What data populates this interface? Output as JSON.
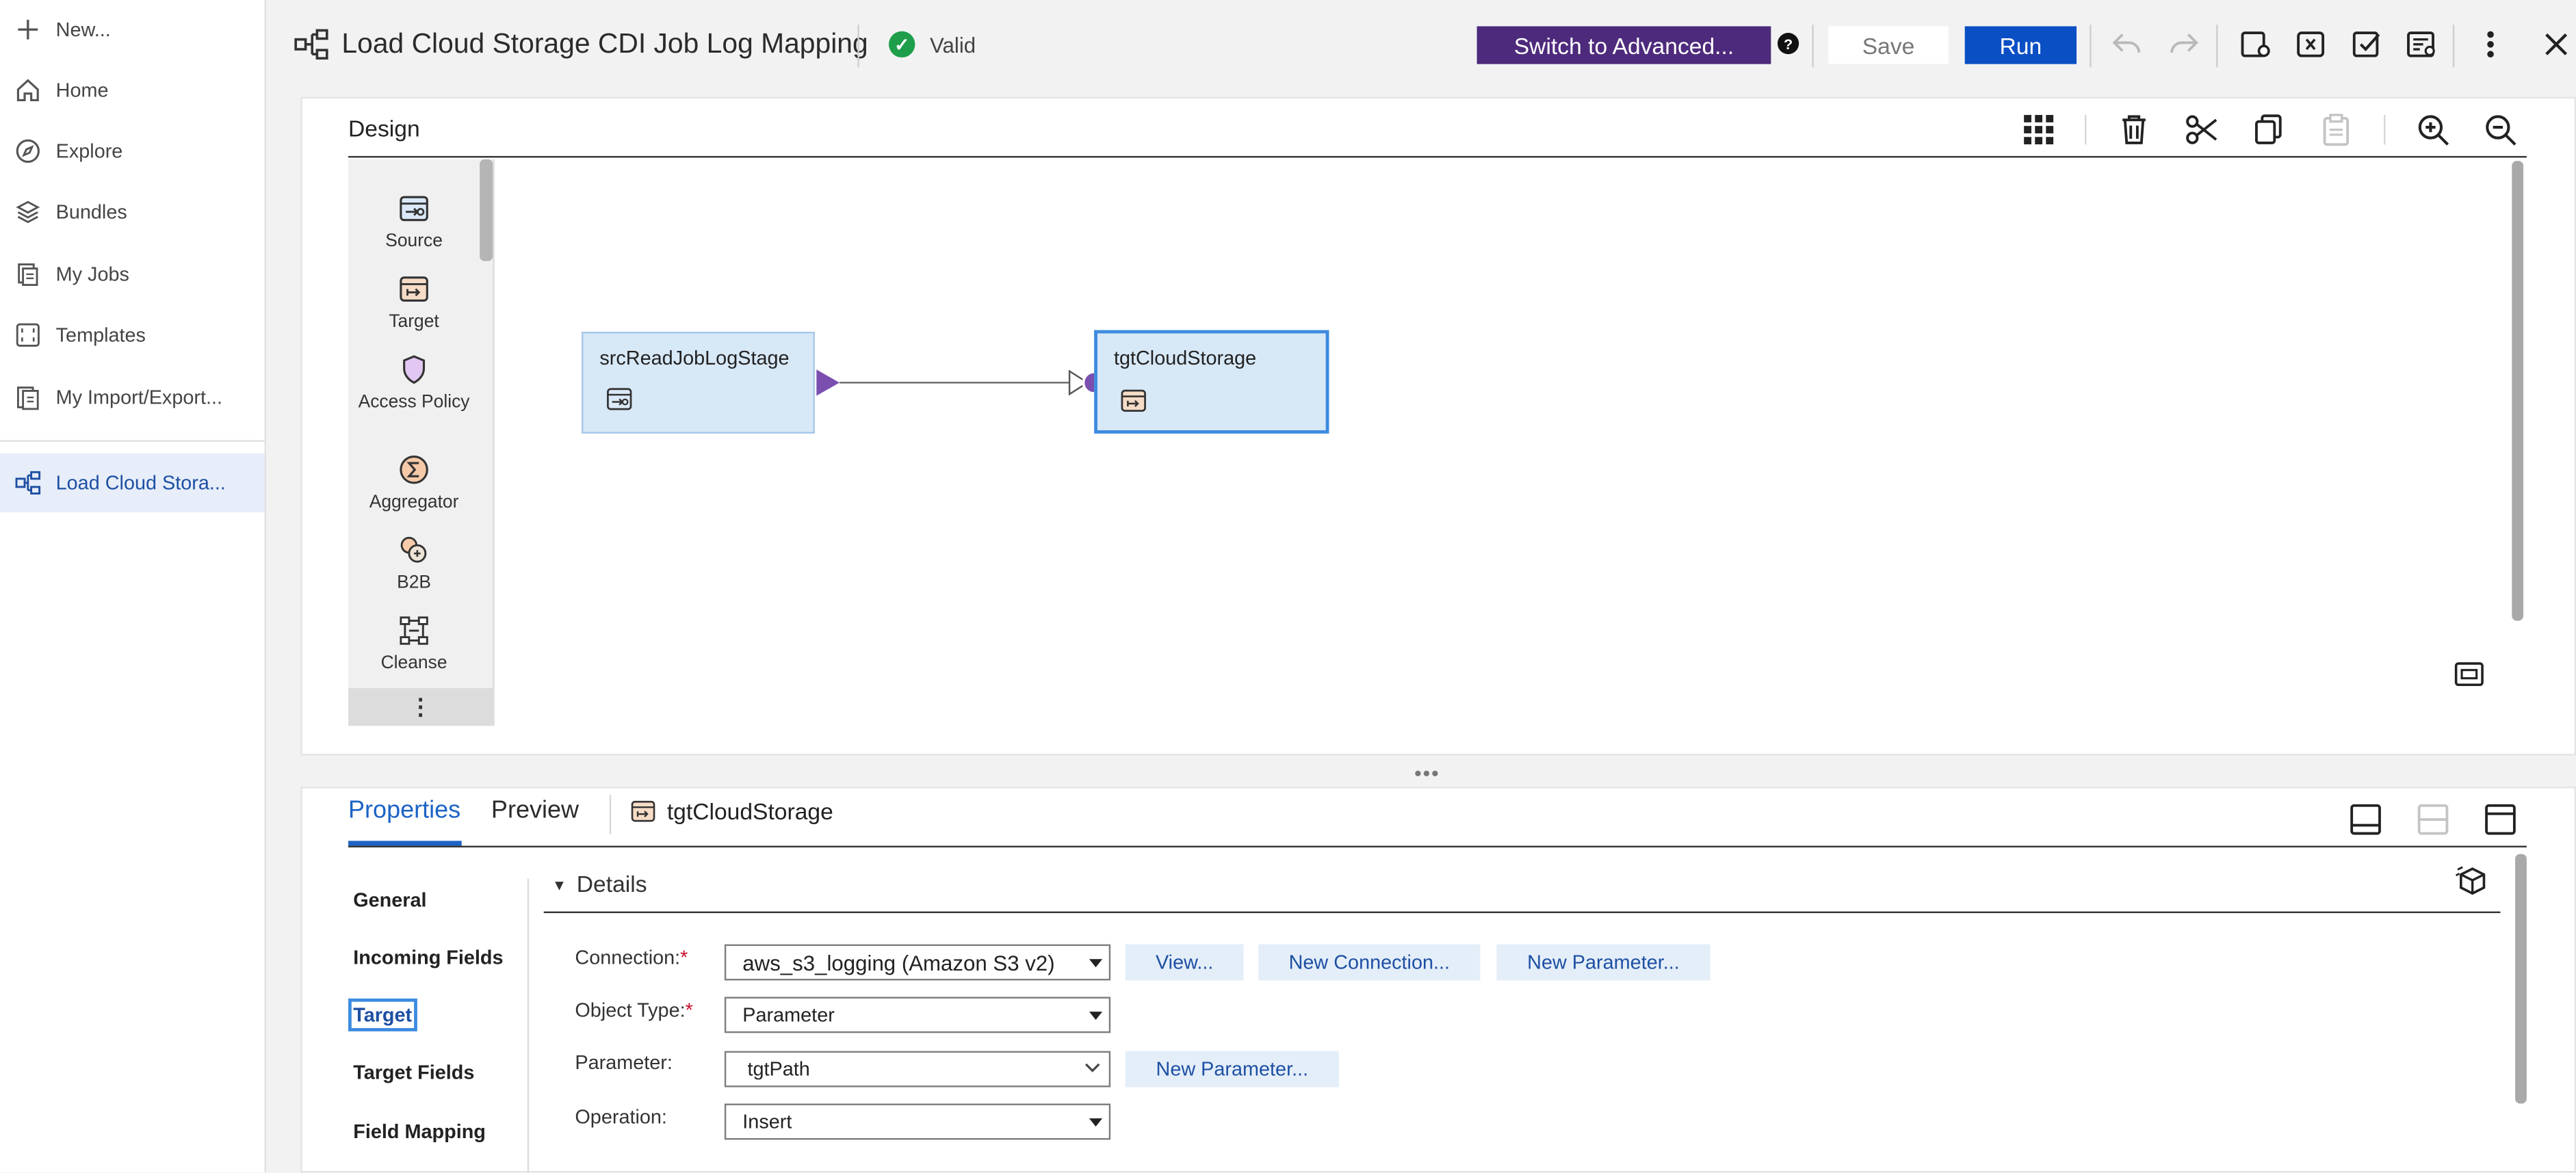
{
  "nav": {
    "new_label": "New...",
    "items": [
      {
        "label": "Home",
        "icon": "home-icon"
      },
      {
        "label": "Explore",
        "icon": "compass-icon"
      },
      {
        "label": "Bundles",
        "icon": "layers-icon"
      },
      {
        "label": "My Jobs",
        "icon": "jobs-icon"
      },
      {
        "label": "Templates",
        "icon": "templates-icon"
      },
      {
        "label": "My Import/Export..."
      }
    ],
    "open_asset": "Load Cloud Stora..."
  },
  "header": {
    "title": "Load Cloud Storage CDI Job Log Mapping",
    "status": "Valid",
    "switch_label": "Switch to Advanced...",
    "help_glyph": "?",
    "save_label": "Save",
    "run_label": "Run"
  },
  "design": {
    "label": "Design",
    "palette": [
      "Source",
      "Target",
      "Access Policy",
      "Aggregator",
      "B2B",
      "Cleanse"
    ],
    "more_glyph": "⋮",
    "nodes": [
      {
        "name": "srcReadJobLogStage",
        "kind": "source"
      },
      {
        "name": "tgtCloudStorage",
        "kind": "target",
        "selected": true
      }
    ]
  },
  "properties": {
    "tabs": [
      "Properties",
      "Preview"
    ],
    "object_name": "tgtCloudStorage",
    "categories": [
      "General",
      "Incoming Fields",
      "Target",
      "Target Fields",
      "Field Mapping"
    ],
    "active_category": "Target",
    "section_title": "Details",
    "fields": {
      "connection": {
        "label": "Connection:",
        "required": "*",
        "value": "aws_s3_logging (Amazon S3 v2)"
      },
      "object_type": {
        "label": "Object Type:",
        "required": "*",
        "value": "Parameter"
      },
      "parameter": {
        "label": "Parameter:",
        "value": "tgtPath"
      },
      "operation": {
        "label": "Operation:",
        "value": "Insert"
      }
    },
    "buttons": {
      "view": "View...",
      "new_connection": "New Connection...",
      "new_parameter": "New Parameter..."
    }
  },
  "colors": {
    "accent_purple": "#4e2a7c",
    "run_blue": "#0b4fc4",
    "link_blue": "#1d4fa3",
    "valid_green": "#1e9e4a",
    "node_fill": "#d7e8f7",
    "port_purple": "#7a4fb0"
  }
}
